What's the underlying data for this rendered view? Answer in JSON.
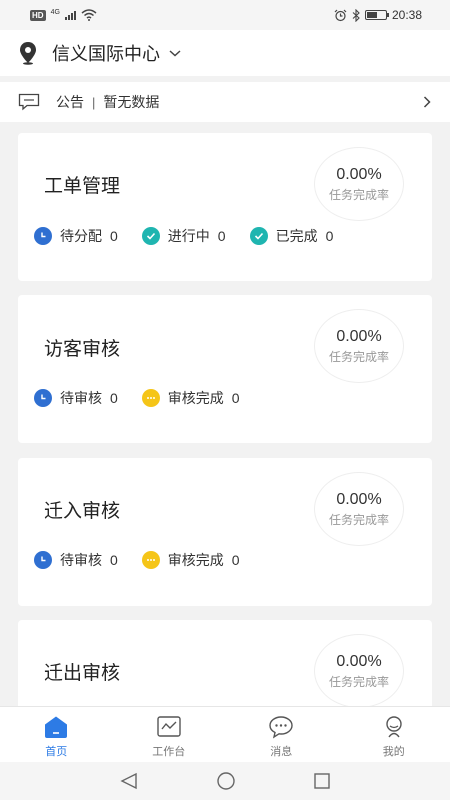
{
  "status_bar": {
    "badge": "HD",
    "network": "4G",
    "time": "20:38",
    "battery_level": 0.55
  },
  "header": {
    "location_name": "信义国际中心"
  },
  "notice": {
    "label": "公告",
    "separator": "|",
    "text": "暂无数据"
  },
  "cards": [
    {
      "title": "工单管理",
      "rate": "0.00%",
      "rate_label": "任务完成率",
      "stats": [
        {
          "label": "待分配",
          "count": "0",
          "icon": "clock-icon",
          "color": "#2f6fd1"
        },
        {
          "label": "进行中",
          "count": "0",
          "icon": "check-icon",
          "color": "#1fb5b0"
        },
        {
          "label": "已完成",
          "count": "0",
          "icon": "check-icon",
          "color": "#1fb5b0"
        }
      ]
    },
    {
      "title": "访客审核",
      "rate": "0.00%",
      "rate_label": "任务完成率",
      "stats": [
        {
          "label": "待审核",
          "count": "0",
          "icon": "clock-icon",
          "color": "#2f6fd1"
        },
        {
          "label": "审核完成",
          "count": "0",
          "icon": "dots-icon",
          "color": "#f5c518"
        }
      ]
    },
    {
      "title": "迁入审核",
      "rate": "0.00%",
      "rate_label": "任务完成率",
      "stats": [
        {
          "label": "待审核",
          "count": "0",
          "icon": "clock-icon",
          "color": "#2f6fd1"
        },
        {
          "label": "审核完成",
          "count": "0",
          "icon": "dots-icon",
          "color": "#f5c518"
        }
      ]
    },
    {
      "title": "迁出审核",
      "rate": "0.00%",
      "rate_label": "任务完成率"
    }
  ],
  "bottom_nav": [
    {
      "label": "首页",
      "icon": "home-icon",
      "active": true
    },
    {
      "label": "工作台",
      "icon": "workbench-icon",
      "active": false
    },
    {
      "label": "消息",
      "icon": "message-icon",
      "active": false
    },
    {
      "label": "我的",
      "icon": "profile-icon",
      "active": false
    }
  ],
  "colors": {
    "accent": "#2d7be5",
    "pending_blue": "#2f6fd1",
    "done_teal": "#1fb5b0",
    "review_yellow": "#f5c518"
  }
}
